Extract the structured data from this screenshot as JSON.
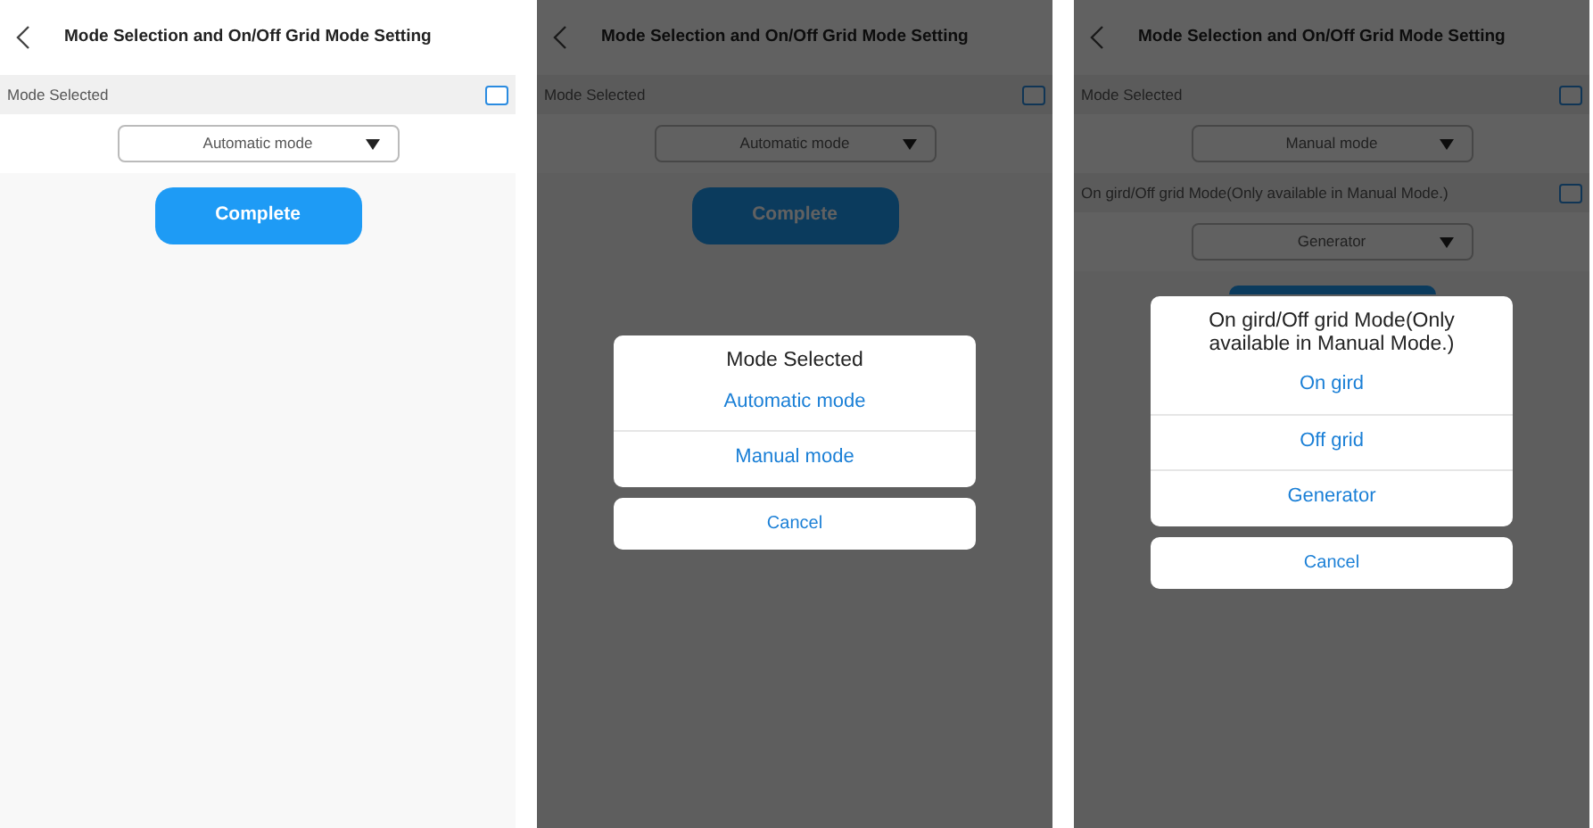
{
  "screens": [
    {
      "title": "Mode Selection and On/Off Grid Mode Setting",
      "settings": [
        {
          "label": "Mode Selected",
          "checked": false,
          "value": "Automatic mode"
        }
      ],
      "complete_button": {
        "label": "Complete"
      }
    },
    {
      "title": "Mode Selection and On/Off Grid Mode Setting",
      "settings": [
        {
          "label": "Mode Selected",
          "checked": false,
          "value": "Automatic mode"
        }
      ],
      "complete_button": {
        "label": "Complete"
      },
      "action_sheet": {
        "title": "Mode Selected",
        "options": [
          "Automatic mode",
          "Manual mode"
        ],
        "cancel": "Cancel"
      }
    },
    {
      "title": "Mode Selection and On/Off Grid Mode Setting",
      "settings": [
        {
          "label": "Mode Selected",
          "checked": false,
          "value": "Manual mode"
        },
        {
          "label": "On gird/Off grid Mode(Only available in Manual Mode.)",
          "checked": false,
          "value": "Generator"
        }
      ],
      "action_sheet": {
        "title": "On gird/Off grid Mode(Only available in Manual Mode.)",
        "options": [
          "On gird",
          "Off grid",
          "Generator"
        ],
        "cancel": "Cancel"
      }
    }
  ]
}
